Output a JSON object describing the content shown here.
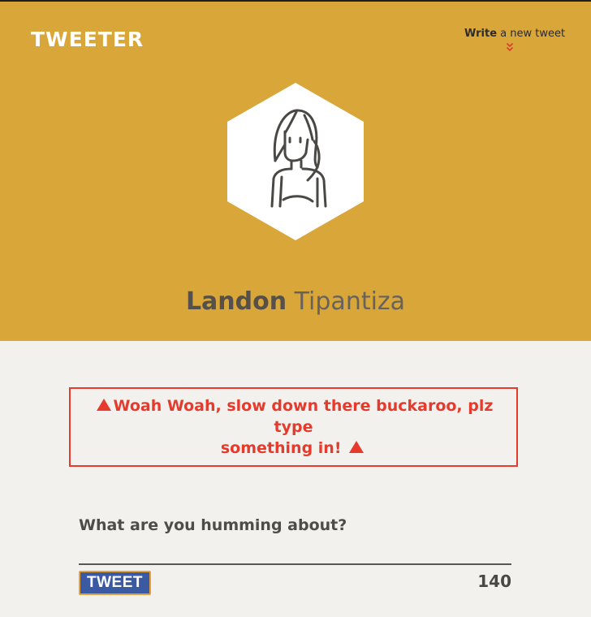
{
  "nav": {
    "brand": "TWEETER",
    "write_strong": "Write",
    "write_rest": " a new tweet",
    "chevron_icon": "double-chevron-down-icon"
  },
  "profile": {
    "first_name": "Landon",
    "last_name": "Tipantiza",
    "avatar_icon": "user-avatar-icon"
  },
  "alert": {
    "message_part1": "Woah Woah, slow down there buckaroo, plz type",
    "message_part2": "something in!",
    "icon": "warning-triangle-icon"
  },
  "composer": {
    "prompt": "What are you humming about?",
    "button_label": "TWEET",
    "counter": "140"
  },
  "colors": {
    "header_bg": "#d9a63a",
    "page_bg": "#f3f1ed",
    "alert": "#e53a2c",
    "button_bg": "#3c5aa1",
    "button_border": "#e5a23b"
  }
}
